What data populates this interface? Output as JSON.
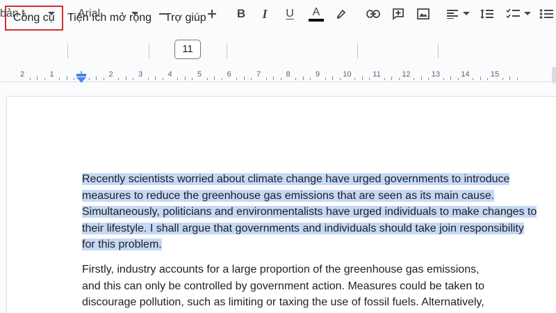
{
  "menu": {
    "items": [
      "Công cụ",
      "Tiện ích mở rộng",
      "Trợ giúp"
    ]
  },
  "toolbar": {
    "style_value": "bản t...",
    "font_value": "Arial",
    "font_size": "11",
    "icons": [
      "chevron-down-icon",
      "minus-icon",
      "plus-icon",
      "bold-icon",
      "italic-icon",
      "underline-icon",
      "text-color-icon",
      "highlight-icon",
      "link-icon",
      "comment-icon",
      "image-icon",
      "align-icon",
      "line-spacing-icon",
      "checklist-icon",
      "bulleted-list-icon"
    ],
    "bold_label": "B",
    "italic_label": "I",
    "underline_label": "U",
    "text_color_label": "A"
  },
  "ruler": {
    "labels": [
      "2",
      "1",
      "1",
      "2",
      "3",
      "4",
      "5",
      "6",
      "7",
      "8",
      "9",
      "10",
      "11",
      "12",
      "13",
      "14",
      "15"
    ],
    "colors": {
      "indent_marker": "#4285f4"
    }
  },
  "document": {
    "paragraph1_lines": [
      "Recently scientists worried about climate change have urged governments to introduce",
      "measures to reduce the greenhouse gas emissions that are seen as its main cause.",
      "Simultaneously, politicians and environmentalists have urged individuals to make changes to",
      "their lifestyle. I shall argue that governments and individuals should take join responsibility",
      "for this problem."
    ],
    "paragraph2_lines": [
      "Firstly, industry accounts for a large proportion of the greenhouse gas emissions,",
      "and this can only be controlled by government action. Measures could be taken to",
      "discourage pollution, such as limiting or taxing the use of fossil fuels. Alternatively,"
    ],
    "selection_color": "#c5d8f7"
  },
  "colors": {
    "highlight_border": "#d32f2f",
    "text_color_bar": "#000000"
  }
}
